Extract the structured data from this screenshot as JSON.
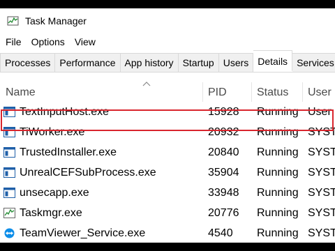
{
  "window": {
    "title": "Task Manager"
  },
  "menu": [
    "File",
    "Options",
    "View"
  ],
  "tabs": [
    {
      "label": "Processes",
      "active": false
    },
    {
      "label": "Performance",
      "active": false
    },
    {
      "label": "App history",
      "active": false
    },
    {
      "label": "Startup",
      "active": false
    },
    {
      "label": "Users",
      "active": false
    },
    {
      "label": "Details",
      "active": true
    },
    {
      "label": "Services",
      "active": false
    }
  ],
  "columns": {
    "name": "Name",
    "pid": "PID",
    "status": "Status",
    "user": "User"
  },
  "rows": [
    {
      "name": "TextInputHost.exe",
      "pid": "15928",
      "status": "Running",
      "user": "User",
      "icon": "app-window-icon",
      "highlighted": true
    },
    {
      "name": "TiWorker.exe",
      "pid": "20932",
      "status": "Running",
      "user": "SYST",
      "icon": "app-window-icon"
    },
    {
      "name": "TrustedInstaller.exe",
      "pid": "20840",
      "status": "Running",
      "user": "SYST",
      "icon": "app-window-icon"
    },
    {
      "name": "UnrealCEFSubProcess.exe",
      "pid": "35904",
      "status": "Running",
      "user": "SYST",
      "icon": "app-window-icon"
    },
    {
      "name": "unsecapp.exe",
      "pid": "33948",
      "status": "Running",
      "user": "SYST",
      "icon": "app-window-icon"
    },
    {
      "name": "Taskmgr.exe",
      "pid": "20776",
      "status": "Running",
      "user": "SYST",
      "icon": "task-manager-icon"
    },
    {
      "name": "TeamViewer_Service.exe",
      "pid": "4540",
      "status": "Running",
      "user": "SYST",
      "icon": "teamviewer-icon"
    }
  ],
  "colors": {
    "highlight": "#d9252d",
    "icon_blue": "#1f5fa8",
    "teamviewer_blue": "#0e8ee9"
  }
}
